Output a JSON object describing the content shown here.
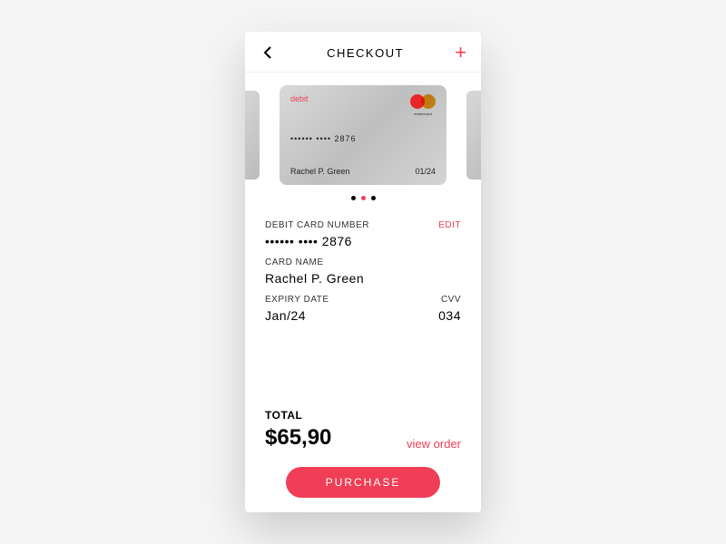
{
  "header": {
    "title": "CHECKOUT"
  },
  "card": {
    "type_label": "debit",
    "brand": "mastercard",
    "number_masked": "•••••• •••• 2876",
    "holder": "Rachel P. Green",
    "expiry_short": "01/24"
  },
  "carousel": {
    "count": 3,
    "active_index": 1
  },
  "form": {
    "number_label": "DEBIT CARD NUMBER",
    "edit_label": "EDIT",
    "number_value": "•••••• •••• 2876",
    "name_label": "CARD NAME",
    "name_value": "Rachel P. Green",
    "expiry_label": "EXPIRY DATE",
    "expiry_value": "Jan/24",
    "cvv_label": "CVV",
    "cvv_value": "034"
  },
  "totals": {
    "label": "TOTAL",
    "amount": "$65,90",
    "view_order_label": "view order"
  },
  "actions": {
    "purchase_label": "PURCHASE"
  },
  "colors": {
    "accent": "#ef3e56"
  }
}
